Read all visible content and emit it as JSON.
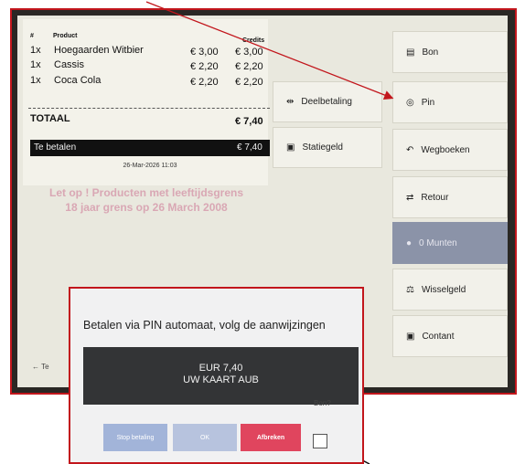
{
  "receipt": {
    "headers": {
      "qty": "#",
      "product": "Product",
      "credits": "Credits"
    },
    "items": [
      {
        "qty": "1x",
        "name": "Hoegaarden Witbier",
        "price": "€ 3,00",
        "credits": "€ 3,00"
      },
      {
        "qty": "1x",
        "name": "Cassis",
        "price": "€ 2,20",
        "credits": "€ 2,20"
      },
      {
        "qty": "1x",
        "name": "Coca Cola",
        "price": "€ 2,20",
        "credits": "€ 2,20"
      }
    ],
    "total_label": "TOTAAL",
    "total_value": "€ 7,40",
    "pay_label": "Te betalen",
    "pay_value": "€ 7,40",
    "date": "26-Mar-2026 11:03"
  },
  "warning": {
    "line1": "Let op ! Producten met leeftijdsgrens",
    "line2": "18 jaar grens op 26 March 2008"
  },
  "middle_buttons": {
    "deelbetaling": "Deelbetaling",
    "statiegeld": "Statiegeld"
  },
  "right_buttons": {
    "bon": "Bon",
    "pin": "Pin",
    "wegboeken": "Wegboeken",
    "retour": "Retour",
    "munten": "0 Munten",
    "wisselgeld": "Wisselgeld",
    "contant": "Contant"
  },
  "bottom_left": {
    "label": "Te"
  },
  "dialog": {
    "title": "Betalen via PIN automaat, volg de aanwijzingen",
    "pin_line1": "EUR 7,40",
    "pin_line2": "UW KAART AUB",
    "stop_label": "Stop betaling",
    "ok_label": "OK",
    "afbreken_label": "Afbreken",
    "bon_label": "Bon?"
  },
  "colors": {
    "frame_red": "#c2161c",
    "screen_bg": "#e9e8de",
    "highlight_button": "#8b93a8",
    "afbreken": "#e0455e",
    "warning_text": "#d9a7b4"
  }
}
